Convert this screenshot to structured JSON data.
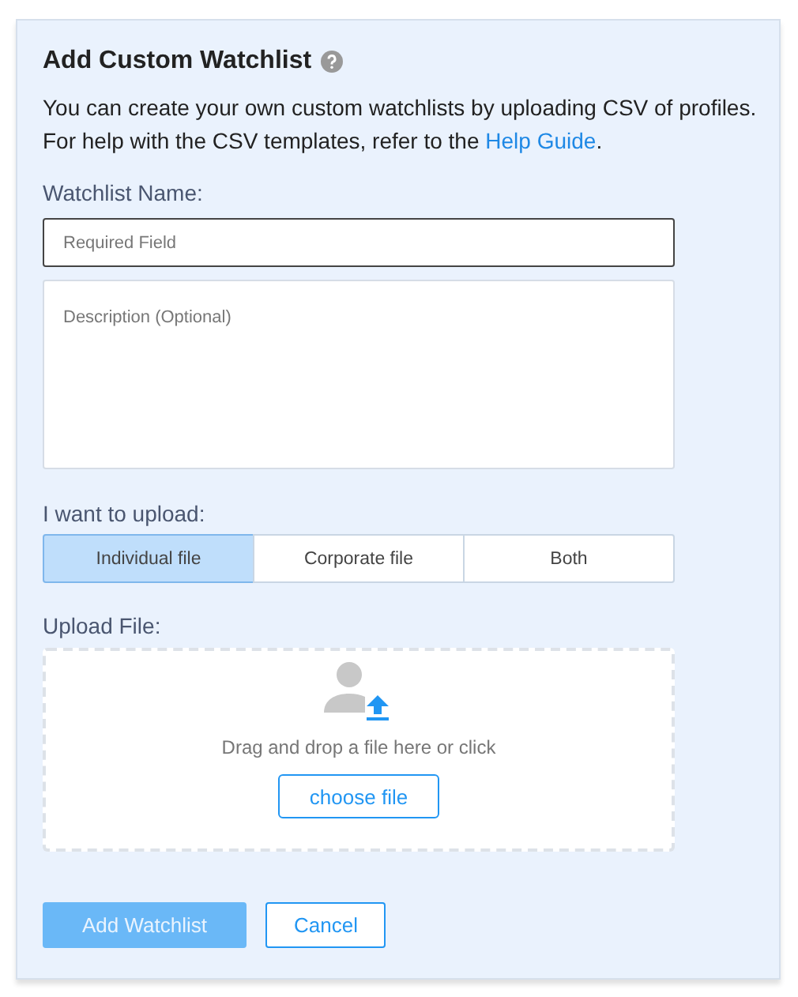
{
  "title": "Add Custom Watchlist",
  "intro": "You can create your own custom watchlists by uploading CSV of profiles. For help with the CSV templates, refer to the ",
  "help_link": "Help Guide",
  "intro_end": ".",
  "name_label": "Watchlist Name:",
  "name_field": {
    "placeholder": "Required Field"
  },
  "description_field": {
    "placeholder": "Description (Optional)"
  },
  "upload_type_label": "I want to upload:",
  "upload_types": [
    {
      "label": "Individual file",
      "selected": true
    },
    {
      "label": "Corporate file",
      "selected": false
    },
    {
      "label": "Both",
      "selected": false
    }
  ],
  "upload_file_label": "Upload File:",
  "dropzone": {
    "hint": "Drag and drop a file here or click",
    "button": "choose file"
  },
  "actions": [
    {
      "label": "Add Watchlist",
      "kind": "primary",
      "disabled": true
    },
    {
      "label": "Cancel",
      "kind": "secondary",
      "disabled": false
    }
  ]
}
